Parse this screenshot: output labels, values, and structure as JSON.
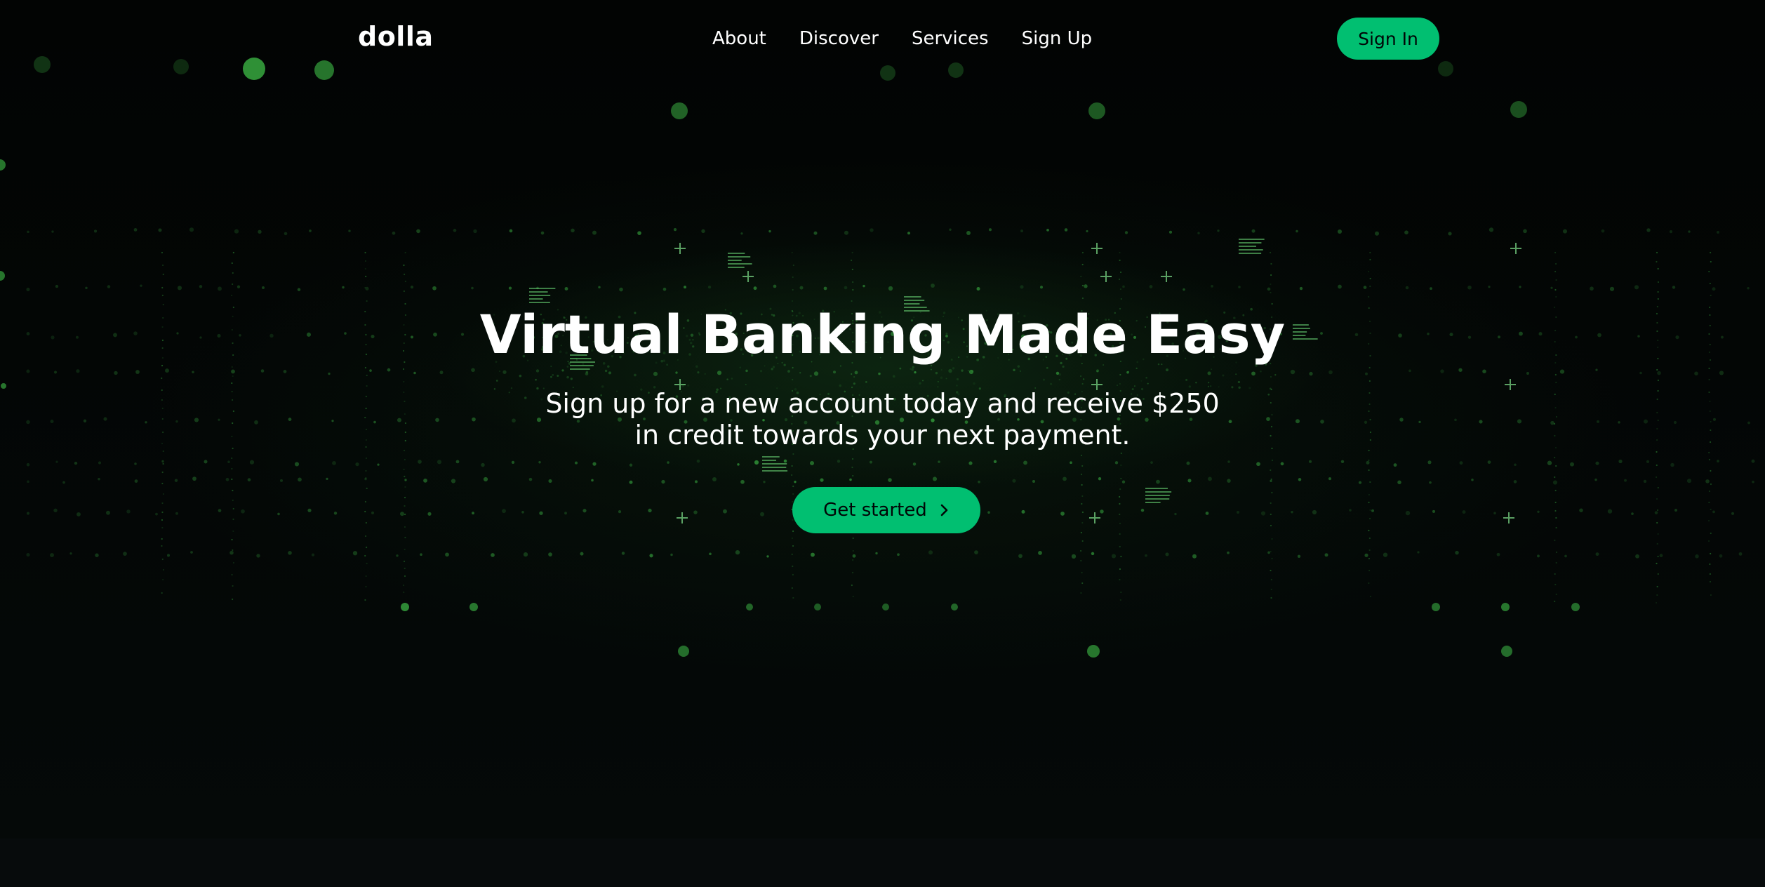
{
  "navbar": {
    "logo": "dolla",
    "links": [
      {
        "label": "About"
      },
      {
        "label": "Discover"
      },
      {
        "label": "Services"
      },
      {
        "label": "Sign Up"
      }
    ],
    "signin_label": "Sign In"
  },
  "hero": {
    "title": "Virtual Banking Made Easy",
    "subtitle_line1": "Sign up for a new account today and receive $250",
    "subtitle_line2": "in credit towards your next payment.",
    "cta_label": "Get started",
    "cta_icon": "chevron-right-icon"
  },
  "colors": {
    "accent": "#01bf71",
    "background": "#050807",
    "text": "#ffffff",
    "particle": "#3fbf48"
  }
}
